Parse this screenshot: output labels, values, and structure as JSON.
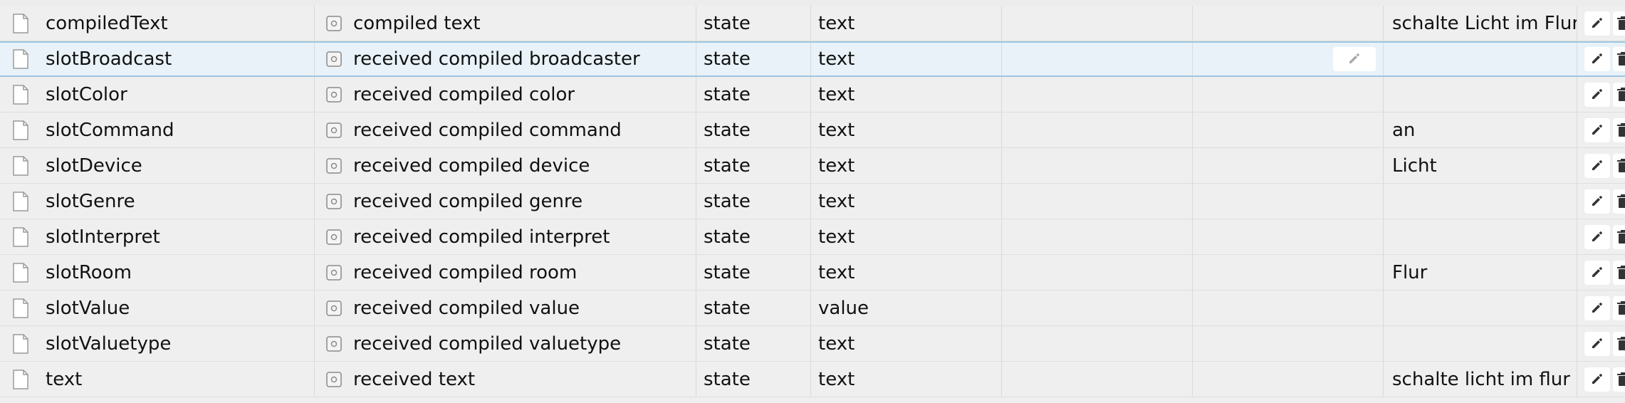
{
  "rows": [
    {
      "id": "compiledText",
      "name": "compiled text",
      "type": "state",
      "role": "text",
      "value": "schalte Licht im Flur an"
    },
    {
      "id": "slotBroadcast",
      "name": "received compiled broadcaster",
      "type": "state",
      "role": "text",
      "value": ""
    },
    {
      "id": "slotColor",
      "name": "received compiled color",
      "type": "state",
      "role": "text",
      "value": ""
    },
    {
      "id": "slotCommand",
      "name": "received compiled command",
      "type": "state",
      "role": "text",
      "value": "an"
    },
    {
      "id": "slotDevice",
      "name": "received compiled device",
      "type": "state",
      "role": "text",
      "value": "Licht"
    },
    {
      "id": "slotGenre",
      "name": "received compiled genre",
      "type": "state",
      "role": "text",
      "value": ""
    },
    {
      "id": "slotInterpret",
      "name": "received compiled interpret",
      "type": "state",
      "role": "text",
      "value": ""
    },
    {
      "id": "slotRoom",
      "name": "received compiled room",
      "type": "state",
      "role": "text",
      "value": "Flur"
    },
    {
      "id": "slotValue",
      "name": "received compiled value",
      "type": "state",
      "role": "value",
      "value": ""
    },
    {
      "id": "slotValuetype",
      "name": "received compiled valuetype",
      "type": "state",
      "role": "text",
      "value": ""
    },
    {
      "id": "text",
      "name": "received text",
      "type": "state",
      "role": "text",
      "value": "schalte licht im flur an"
    }
  ],
  "selected_row_index": 1,
  "icons": {
    "row_icon": "file-icon",
    "state_icon": "state-icon",
    "edit_icon": "pencil-icon",
    "delete_icon": "trash-icon"
  },
  "colors": {
    "background": "#efefef",
    "selected_background": "#e8f2f8",
    "selected_border": "#9cc8e0",
    "grid_line": "#d9d9d9"
  }
}
